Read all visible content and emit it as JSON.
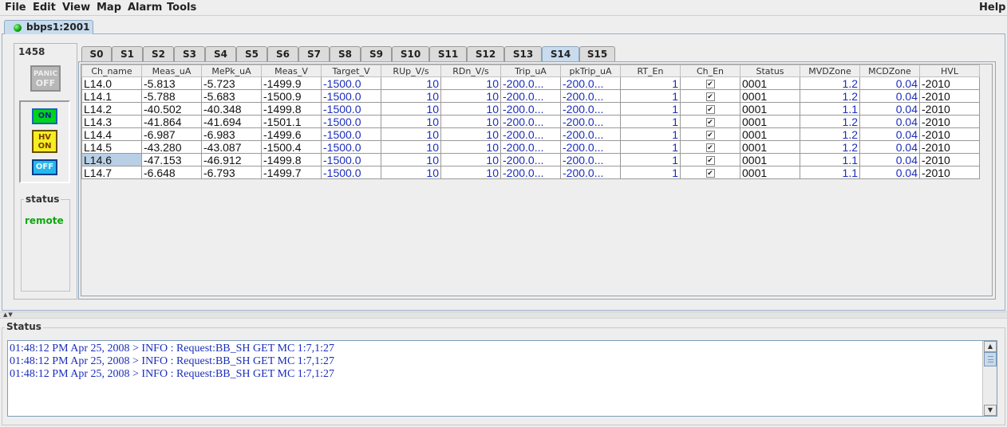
{
  "menu": {
    "file": "File",
    "edit": "Edit",
    "view": "View",
    "map": "Map",
    "alarm": "Alarm",
    "tools": "Tools",
    "help": "Help"
  },
  "connection_tab": {
    "label": "bbps1:2001",
    "status_color": "#1aa51a"
  },
  "left_panel": {
    "crate_number": "1458",
    "panic_button": {
      "line1": "PANIC",
      "line2": "OFF"
    },
    "on_button": "ON",
    "hv_on_button": {
      "line1": "HV",
      "line2": "ON"
    },
    "off_button": "OFF",
    "status_title": "status",
    "status_value": "remote"
  },
  "slot_tabs": [
    "S0",
    "S1",
    "S2",
    "S3",
    "S4",
    "S5",
    "S6",
    "S7",
    "S8",
    "S9",
    "S10",
    "S11",
    "S12",
    "S13",
    "S14",
    "S15"
  ],
  "active_slot_tab": "S14",
  "table": {
    "columns": [
      "Ch_name",
      "Meas_uA",
      "MePk_uA",
      "Meas_V",
      "Target_V",
      "RUp_V/s",
      "RDn_V/s",
      "Trip_uA",
      "pkTrip_uA",
      "RT_En",
      "Ch_En",
      "Status",
      "MVDZone",
      "MCDZone",
      "HVL"
    ],
    "rows": [
      {
        "ch_name": "L14.0",
        "meas_ua": "-5.813",
        "mepk_ua": "-5.723",
        "meas_v": "-1499.9",
        "target_v": "-1500.0",
        "rup": "10",
        "rdn": "10",
        "trip": "-200.0...",
        "pktrip": "-200.0...",
        "rt_en": "1",
        "ch_en": "✔",
        "status": "0001",
        "mvd": "1.2",
        "mcd": "0.04",
        "hvl": "-2010"
      },
      {
        "ch_name": "L14.1",
        "meas_ua": "-5.788",
        "mepk_ua": "-5.683",
        "meas_v": "-1500.9",
        "target_v": "-1500.0",
        "rup": "10",
        "rdn": "10",
        "trip": "-200.0...",
        "pktrip": "-200.0...",
        "rt_en": "1",
        "ch_en": "✔",
        "status": "0001",
        "mvd": "1.2",
        "mcd": "0.04",
        "hvl": "-2010"
      },
      {
        "ch_name": "L14.2",
        "meas_ua": "-40.502",
        "mepk_ua": "-40.348",
        "meas_v": "-1499.8",
        "target_v": "-1500.0",
        "rup": "10",
        "rdn": "10",
        "trip": "-200.0...",
        "pktrip": "-200.0...",
        "rt_en": "1",
        "ch_en": "✔",
        "status": "0001",
        "mvd": "1.1",
        "mcd": "0.04",
        "hvl": "-2010"
      },
      {
        "ch_name": "L14.3",
        "meas_ua": "-41.864",
        "mepk_ua": "-41.694",
        "meas_v": "-1501.1",
        "target_v": "-1500.0",
        "rup": "10",
        "rdn": "10",
        "trip": "-200.0...",
        "pktrip": "-200.0...",
        "rt_en": "1",
        "ch_en": "✔",
        "status": "0001",
        "mvd": "1.2",
        "mcd": "0.04",
        "hvl": "-2010"
      },
      {
        "ch_name": "L14.4",
        "meas_ua": "-6.987",
        "mepk_ua": "-6.983",
        "meas_v": "-1499.6",
        "target_v": "-1500.0",
        "rup": "10",
        "rdn": "10",
        "trip": "-200.0...",
        "pktrip": "-200.0...",
        "rt_en": "1",
        "ch_en": "✔",
        "status": "0001",
        "mvd": "1.2",
        "mcd": "0.04",
        "hvl": "-2010"
      },
      {
        "ch_name": "L14.5",
        "meas_ua": "-43.280",
        "mepk_ua": "-43.087",
        "meas_v": "-1500.4",
        "target_v": "-1500.0",
        "rup": "10",
        "rdn": "10",
        "trip": "-200.0...",
        "pktrip": "-200.0...",
        "rt_en": "1",
        "ch_en": "✔",
        "status": "0001",
        "mvd": "1.2",
        "mcd": "0.04",
        "hvl": "-2010"
      },
      {
        "ch_name": "L14.6",
        "meas_ua": "-47.153",
        "mepk_ua": "-46.912",
        "meas_v": "-1499.8",
        "target_v": "-1500.0",
        "rup": "10",
        "rdn": "10",
        "trip": "-200.0...",
        "pktrip": "-200.0...",
        "rt_en": "1",
        "ch_en": "✔",
        "status": "0001",
        "mvd": "1.1",
        "mcd": "0.04",
        "hvl": "-2010"
      },
      {
        "ch_name": "L14.7",
        "meas_ua": "-6.648",
        "mepk_ua": "-6.793",
        "meas_v": "-1499.7",
        "target_v": "-1500.0",
        "rup": "10",
        "rdn": "10",
        "trip": "-200.0...",
        "pktrip": "-200.0...",
        "rt_en": "1",
        "ch_en": "✔",
        "status": "0001",
        "mvd": "1.1",
        "mcd": "0.04",
        "hvl": "-2010"
      }
    ],
    "selected_row": 6
  },
  "status_section": {
    "title": "Status",
    "log_lines": [
      "01:48:12 PM Apr 25, 2008 > INFO : Request:BB_SH GET MC 1:7,1:27",
      "01:48:12 PM Apr 25, 2008 > INFO : Request:BB_SH GET MC 1:7,1:27",
      "01:48:12 PM Apr 25, 2008 > INFO : Request:BB_SH GET MC 1:7,1:27"
    ]
  }
}
